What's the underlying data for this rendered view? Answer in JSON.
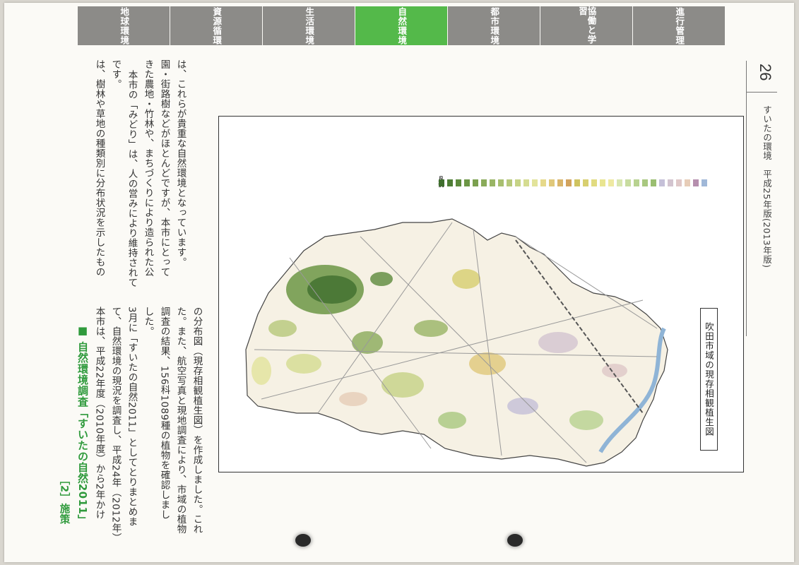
{
  "tabs": [
    {
      "label": "地球環境",
      "active": false
    },
    {
      "label": "資源循環",
      "active": false
    },
    {
      "label": "生活環境",
      "active": false
    },
    {
      "label": "自然環境",
      "active": true
    },
    {
      "label": "都市環境",
      "active": false
    },
    {
      "label": "協働と学習",
      "active": false
    },
    {
      "label": "進行管理",
      "active": false
    }
  ],
  "footer": {
    "page_number": "26",
    "publication": "すいたの環境　平成25年版(2013年版)"
  },
  "section": {
    "label": "［2］施策",
    "heading": "■ 自然環境調査「すいたの自然2011」",
    "paragraph_lines": [
      "本市は、平成22年度（2010年度）から2年かけ",
      "て、自然環境の現況を調査し、平成24年（2012年）",
      "3月に「すいたの自然2011」としてとりまとめま",
      "した。",
      "調査の結果、156科1089種の植物を確認しまし",
      "た。また、航空写真と現地調査により、市域の植物",
      "の分布図（現存相観植生図）を作成しました。これ",
      "は、樹林や草地の種類別に分布状況を示したもの",
      "です。",
      "本市の「みどり」は、人の営みにより維持されて",
      "きた農地・竹林や、まちづくりにより造られた公",
      "園・街路樹などがほとんどですが、本市にとって",
      "は、これらが貴重な自然環境となっています。"
    ]
  },
  "figure": {
    "caption": "吹田市域の現存相観植生図",
    "legend_title": "凡例",
    "legend_colors": [
      "#3f6e2e",
      "#4e7d35",
      "#5d8a3c",
      "#6c9645",
      "#7ba04f",
      "#8aab5a",
      "#99b565",
      "#a8bf70",
      "#b7c97b",
      "#c6d386",
      "#d5dc91",
      "#e2e39b",
      "#e6d98a",
      "#e0c87a",
      "#d9b56a",
      "#d2a35d",
      "#cfc35f",
      "#d8cf6f",
      "#e1db80",
      "#e9e591",
      "#eee9a2",
      "#d8e6b0",
      "#c8dca0",
      "#b8d290",
      "#a9c880",
      "#9abe71",
      "#c5c0d8",
      "#d3c4cf",
      "#dfc8c8",
      "#e7cdb8",
      "#b68fae",
      "#a0b8d8"
    ]
  }
}
